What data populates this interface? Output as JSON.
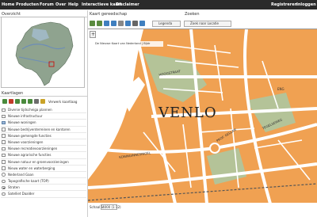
{
  "topnav": {
    "items": [
      "Home",
      "Producten",
      "Forum",
      "Over",
      "Help",
      "Interactieve kaart",
      "Disclaimer"
    ],
    "right_items": [
      "Registreren",
      "Inloggen"
    ]
  },
  "overview": {
    "title": "Overzicht"
  },
  "map_panel": {
    "title": "Kaart gereedschap",
    "legend_label": "Legenda",
    "copyright": "De Nieuwe Kaart van Nederland | Bijdr",
    "city_label": "VENLO",
    "street_labels": [
      "HOOGSTRAAT",
      "PROF. GELLAN",
      "KONINGINNESINGEL",
      "TEGELSEWEG",
      "ENG"
    ],
    "scale_label": "Schaal 1 :",
    "scale_value": "4000 (1:12)"
  },
  "search_panel": {
    "title": "Zoeken",
    "search_label": "Zoek naar Locatie"
  },
  "layers_panel": {
    "title": "Kaartlagen",
    "toolbar_label": "Verwerk kaartlaag",
    "layers": [
      {
        "label": "Diverse tijdscheiga plannen",
        "type": "checkbox",
        "checked": false
      },
      {
        "label": "Nieuwe infrastructuur",
        "type": "checkbox",
        "checked": false
      },
      {
        "label": "Nieuwe woningen",
        "type": "checkbox",
        "checked": true
      },
      {
        "label": "Nieuwe bedrijventerreinen en kantoren",
        "type": "checkbox",
        "checked": false
      },
      {
        "label": "Nieuwe gemengde functies",
        "type": "checkbox",
        "checked": false
      },
      {
        "label": "Nieuwe voorzieningen",
        "type": "checkbox",
        "checked": false
      },
      {
        "label": "Nieuwe recreatievoorzieningen",
        "type": "checkbox",
        "checked": false
      },
      {
        "label": "Nieuwe agrarische functies",
        "type": "checkbox",
        "checked": false
      },
      {
        "label": "Nieuwe natuur en groenvoorzieningen",
        "type": "checkbox",
        "checked": false
      },
      {
        "label": "Nieuw water en waterberging",
        "type": "checkbox",
        "checked": false
      },
      {
        "label": "Nederland Gaan",
        "type": "radio",
        "checked": false
      },
      {
        "label": "Topografische kaart (TOP)",
        "type": "radio",
        "checked": false
      },
      {
        "label": "Straten",
        "type": "radio",
        "checked": true
      },
      {
        "label": "Satelliet Daalder",
        "type": "radio",
        "checked": false
      }
    ]
  },
  "colors": {
    "nav_bg": "#2b2b2b",
    "map_orange": "#f0a152",
    "map_green": "#a9c9a4",
    "map_water": "#ffffff",
    "map_road": "#ffffff"
  }
}
